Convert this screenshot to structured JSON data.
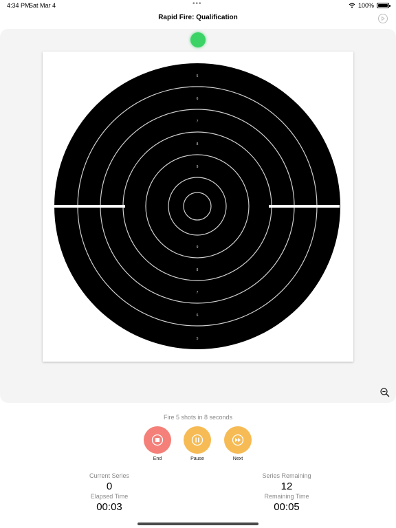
{
  "status_bar": {
    "time": "4:34 PM",
    "date": "Sat Mar 4",
    "dots": "•••",
    "battery": "100%"
  },
  "nav": {
    "title": "Rapid Fire: Qualification"
  },
  "target": {
    "indicator_color": "#3bd366",
    "ring_labels_top": [
      "5",
      "6",
      "7",
      "8",
      "9"
    ],
    "ring_labels_bottom": [
      "9",
      "8",
      "7",
      "6",
      "5"
    ]
  },
  "instruction": "Fire 5 shots in 8 seconds",
  "controls": {
    "end_label": "End",
    "pause_label": "Pause",
    "next_label": "Next"
  },
  "stats": {
    "current_series_label": "Current Series",
    "current_series_value": "0",
    "series_remaining_label": "Series Remaining",
    "series_remaining_value": "12",
    "elapsed_time_label": "Elapsed Time",
    "elapsed_time_value": "00:03",
    "remaining_time_label": "Remaining Time",
    "remaining_time_value": "00:05"
  },
  "colors": {
    "end": "#f48079",
    "pause": "#f6bb54",
    "next": "#f6bb54",
    "panel": "#f4f4f4"
  }
}
